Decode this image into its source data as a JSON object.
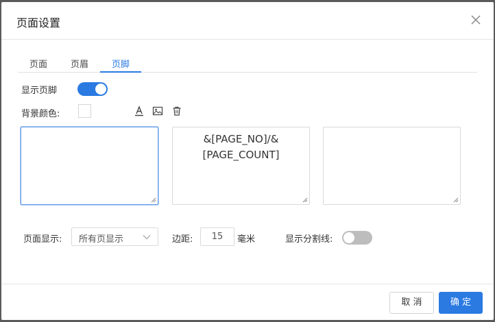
{
  "dialog": {
    "title": "页面设置",
    "close_icon": "close-icon"
  },
  "tabs": [
    {
      "label": "页面",
      "active": false
    },
    {
      "label": "页眉",
      "active": false
    },
    {
      "label": "页脚",
      "active": true
    }
  ],
  "footer_settings": {
    "show_footer_label": "显示页脚",
    "show_footer": true,
    "bg_color_label": "背景颜色:",
    "bg_color": "#ffffff",
    "toolbar_icons": [
      "text-color-icon",
      "image-icon",
      "trash-icon"
    ],
    "left_text": "",
    "center_text": "&[PAGE_NO]/&[PAGE_COUNT]",
    "center_text_lines": [
      "&[PAGE_NO]/&",
      "[PAGE_COUNT]"
    ],
    "right_text": "",
    "page_display_label": "页面显示:",
    "page_display_value": "所有页显示",
    "margin_label": "边距:",
    "margin_value": "15",
    "margin_unit": "毫米",
    "show_divider_label": "显示分割线:",
    "show_divider": false
  },
  "buttons": {
    "cancel": "取 消",
    "ok": "确 定"
  },
  "colors": {
    "accent": "#2a7ae2",
    "toggle_off": "#bdbdbd",
    "overlay": "#5a5a5a"
  }
}
